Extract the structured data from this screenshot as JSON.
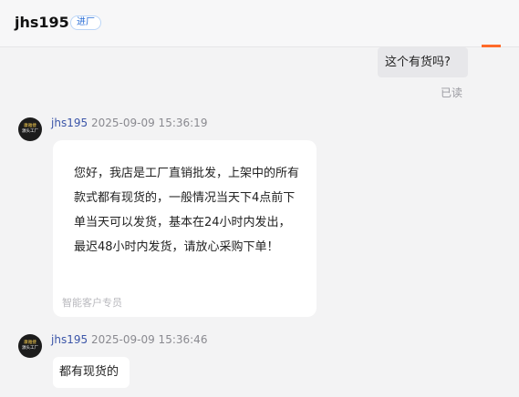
{
  "header": {
    "title": "jhs195",
    "tag": "进厂"
  },
  "outgoing": {
    "text": "这个有货吗?",
    "status": "已读"
  },
  "avatar": {
    "line1": "康雅捷",
    "line2": "源头工厂"
  },
  "messages": [
    {
      "sender": "jhs195",
      "time": "2025-09-09 15:36:19",
      "text": "您好，我店是工厂直销批发，上架中的所有款式都有现货的，一般情况当天下4点前下单当天可以发货，基本在24小时内发出，最迟48小时内发货，请放心采购下单！",
      "footer": "智能客户专员"
    },
    {
      "sender": "jhs195",
      "time": "2025-09-09 15:36:46",
      "text": "都有现货的"
    }
  ]
}
